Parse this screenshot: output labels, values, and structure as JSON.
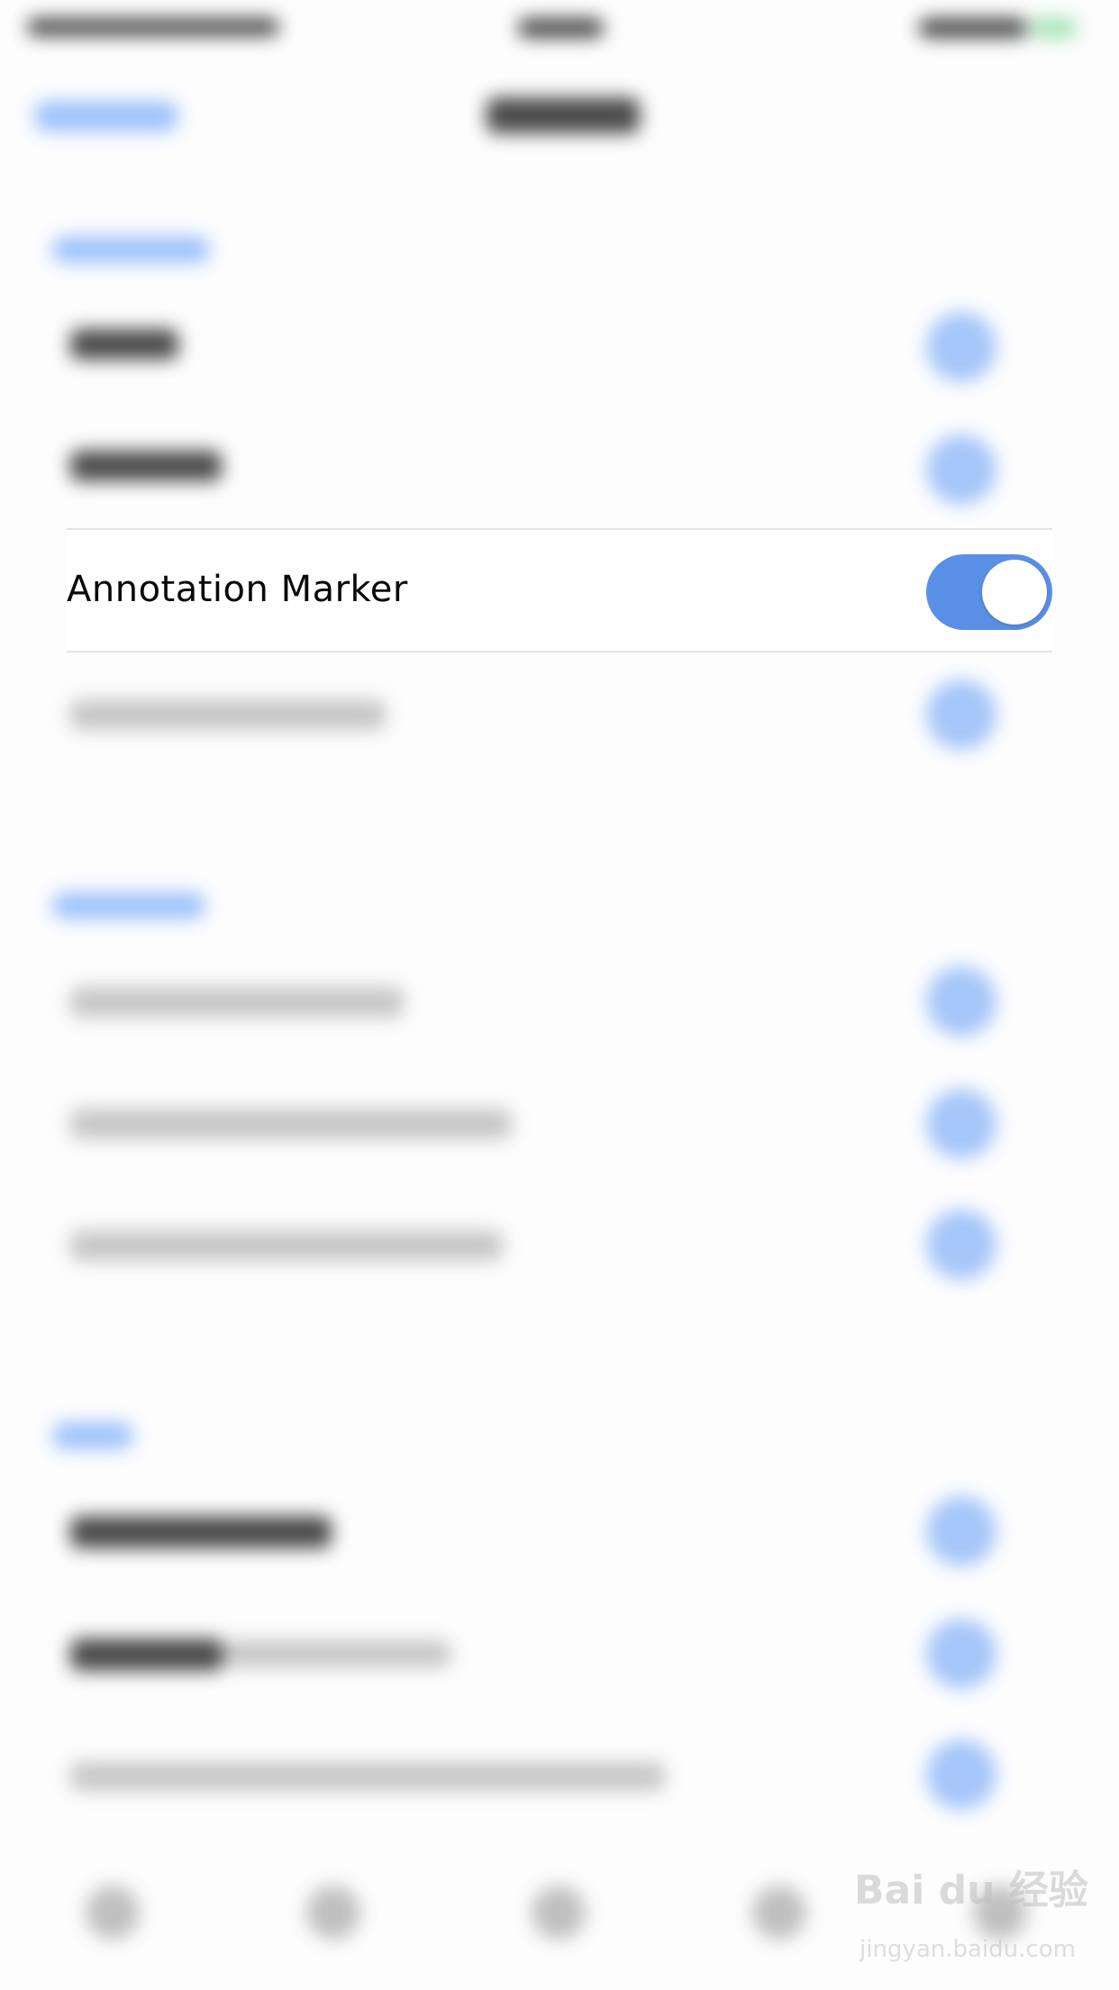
{
  "settings": {
    "annotation_marker": {
      "label": "Annotation Marker",
      "enabled": true
    }
  },
  "watermark": {
    "logo_text": "Bai du 经验",
    "url": "jingyan.baidu.com"
  },
  "colors": {
    "toggle_on": "#5a8fe6",
    "accent_blur": "#2f7ff5",
    "divider": "#e2e2ea",
    "text": "#0a0a0a"
  },
  "icons": {
    "toggle": "toggle-switch-icon"
  }
}
